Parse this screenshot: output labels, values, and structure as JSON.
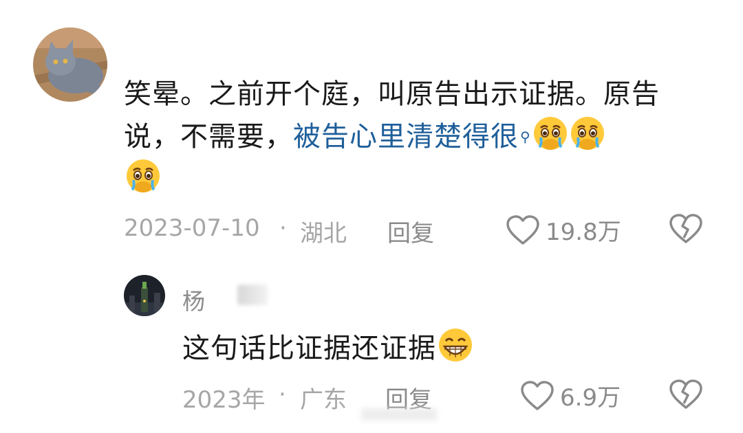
{
  "comment": {
    "avatar_icon": "cat-avatar",
    "text_before": "笑晕。之前开个庭，叫原告出示证据。原告说，不需要，",
    "search_link": "被告心里清楚得很",
    "search_icon": "search-icon",
    "emoji_icon": "crying-face-emoji",
    "date": "2023-07-10",
    "separator": "·",
    "location": "湖北",
    "reply_label": "回复",
    "like_count": "19.8万"
  },
  "sub_comment": {
    "avatar_icon": "city-night-avatar",
    "username": "杨",
    "text": "这句话比证据还证据",
    "emoji_icon": "grinning-face-emoji",
    "date": "2023年",
    "separator": "·",
    "location": "广东",
    "reply_label": "回复",
    "like_count": "6.9万"
  },
  "colors": {
    "link": "#1f5f9a",
    "meta": "#a6a6a6"
  }
}
